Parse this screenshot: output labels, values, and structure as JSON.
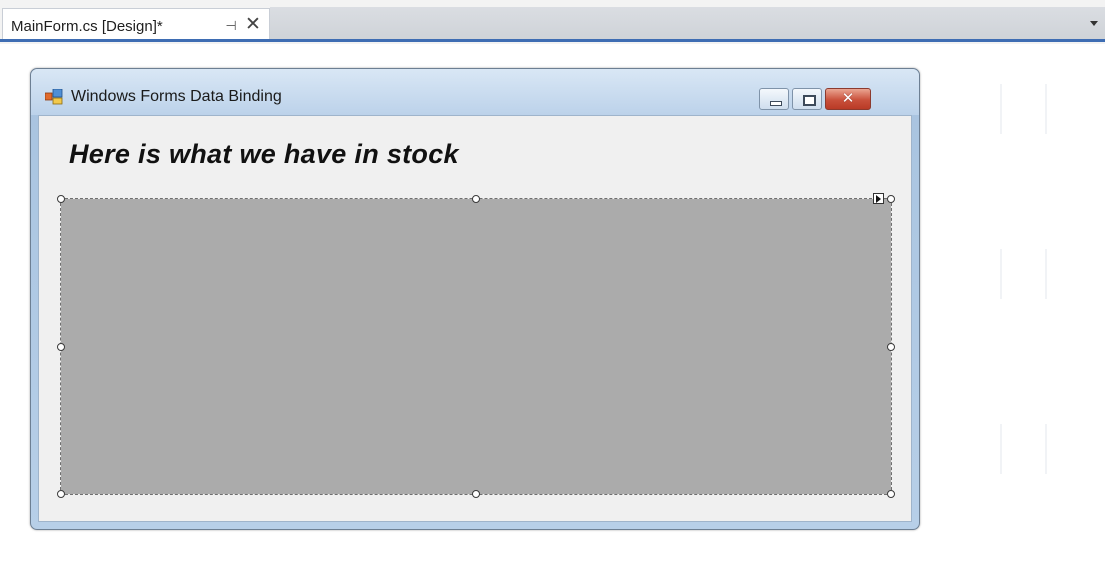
{
  "tabstrip": {
    "active_tab": {
      "title": "MainForm.cs [Design]*",
      "pin_icon": "pin-icon",
      "close_icon": "close-icon",
      "pin_glyph": "⊣",
      "close_glyph": "✕"
    },
    "dropdown_icon": "chevron-down-icon",
    "accent_color": "#3e6db3"
  },
  "form": {
    "title": "Windows Forms Data Binding",
    "icon": "form-app-icon",
    "caption_buttons": {
      "minimize_icon": "minimize-icon",
      "maximize_icon": "maximize-icon",
      "close_icon": "close-icon",
      "close_glyph": "✕"
    },
    "heading": "Here is what we have in stock",
    "grid": {
      "name": "data-grid-view",
      "background_color": "#ababab",
      "smart_tag_icon": "smart-tag-arrow-icon"
    }
  }
}
